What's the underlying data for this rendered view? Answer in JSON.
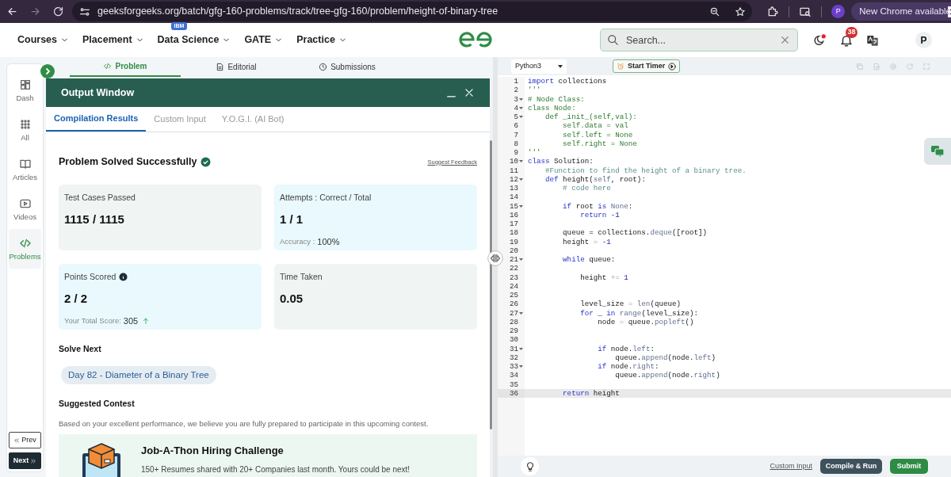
{
  "browser": {
    "url": "geeksforgeeks.org/batch/gfg-160-problems/track/tree-gfg-160/problem/height-of-binary-tree",
    "profile_initial": "P",
    "update_button": "New Chrome available"
  },
  "nav": {
    "items": [
      {
        "label": "Courses"
      },
      {
        "label": "Placement"
      },
      {
        "label": "Data Science",
        "badge": "IBM"
      },
      {
        "label": "GATE"
      },
      {
        "label": "Practice"
      }
    ],
    "search": {
      "placeholder": "Search..."
    },
    "notifications": "38",
    "avatar": "P"
  },
  "sidebar": {
    "items": [
      {
        "label": "Dash",
        "selected": false
      },
      {
        "label": "All",
        "selected": false
      },
      {
        "label": "Articles",
        "selected": false
      },
      {
        "label": "Videos",
        "selected": false
      },
      {
        "label": "Problems",
        "selected": true
      }
    ],
    "prev_button": "Prev",
    "next_button": "Next"
  },
  "problem_tabs": [
    {
      "label": "Problem",
      "selected": true
    },
    {
      "label": "Editorial",
      "selected": false
    },
    {
      "label": "Submissions",
      "selected": false
    }
  ],
  "output_window": {
    "title": "Output Window",
    "tabs": [
      {
        "label": "Compilation Results",
        "selected": true
      },
      {
        "label": "Custom Input",
        "selected": false
      },
      {
        "label": "Y.O.G.I. (AI Bot)",
        "selected": false
      }
    ],
    "result_title": "Problem Solved Successfully",
    "feedback_link": "Suggest Feedback",
    "cards": [
      {
        "label": "Test Cases Passed",
        "value": "1115 / 1115",
        "color": "#f0f5f4",
        "info": false
      },
      {
        "label": "Attempts : Correct / Total",
        "value": "1 / 1",
        "sub_label": "Accuracy :",
        "sub_value": "100%",
        "color": "#e9f9fd",
        "info": false,
        "rising": false
      },
      {
        "label": "Points Scored",
        "value": "2 / 2",
        "sub_label": "Your Total Score:",
        "sub_value": "305",
        "rising": true,
        "color": "#e9f9fd",
        "info": true
      },
      {
        "label": "Time Taken",
        "value": "0.05",
        "color": "#f0f5f4",
        "info": false
      }
    ],
    "solve_next": {
      "heading": "Solve Next",
      "link": "Day 82 - Diameter of a Binary Tree"
    },
    "suggested_contest": {
      "heading": "Suggested Contest",
      "description": "Based on your excellent performance, we believe you are fully prepared to participate in this upcoming contest.",
      "title": "Job-A-Thon Hiring Challenge",
      "text": "150+ Resumes shared with 20+ Companies last month. Yours could be next!"
    }
  },
  "editor": {
    "language": "Python3",
    "timer_button": "Start Timer",
    "lines": [
      {
        "n": "1",
        "fold": false,
        "active": false,
        "tokens": [
          {
            "kind": "keyword",
            "text": "import"
          },
          {
            "kind": "plain",
            "text": " collections"
          }
        ]
      },
      {
        "n": "2",
        "fold": false,
        "active": false,
        "tokens": [
          {
            "kind": "string",
            "text": "'''"
          }
        ]
      },
      {
        "n": "3",
        "fold": true,
        "active": false,
        "tokens": [
          {
            "kind": "string",
            "text": "# Node Class:"
          }
        ]
      },
      {
        "n": "4",
        "fold": true,
        "active": false,
        "tokens": [
          {
            "kind": "string",
            "text": "class Node:"
          }
        ]
      },
      {
        "n": "5",
        "fold": true,
        "active": false,
        "tokens": [
          {
            "kind": "string",
            "text": "    def _init_(self,val):"
          }
        ]
      },
      {
        "n": "6",
        "fold": false,
        "active": false,
        "tokens": [
          {
            "kind": "string",
            "text": "        self.data = val"
          }
        ]
      },
      {
        "n": "7",
        "fold": false,
        "active": false,
        "tokens": [
          {
            "kind": "string",
            "text": "        self.left = None"
          }
        ]
      },
      {
        "n": "8",
        "fold": false,
        "active": false,
        "tokens": [
          {
            "kind": "string",
            "text": "        self.right = None"
          }
        ]
      },
      {
        "n": "9",
        "fold": false,
        "active": false,
        "tokens": [
          {
            "kind": "string",
            "text": "'''"
          }
        ]
      },
      {
        "n": "10",
        "fold": true,
        "active": false,
        "tokens": [
          {
            "kind": "keyword",
            "text": "class"
          },
          {
            "kind": "plain",
            "text": " Solution:"
          }
        ]
      },
      {
        "n": "11",
        "fold": false,
        "active": false,
        "tokens": [
          {
            "kind": "comment",
            "text": "    #Function to find the height of a binary tree."
          }
        ]
      },
      {
        "n": "12",
        "fold": true,
        "active": false,
        "tokens": [
          {
            "kind": "keyword",
            "text": "    def"
          },
          {
            "kind": "plain",
            "text": " height("
          },
          {
            "kind": "builtin",
            "text": "self"
          },
          {
            "kind": "plain",
            "text": ", root):"
          }
        ]
      },
      {
        "n": "13",
        "fold": false,
        "active": false,
        "tokens": [
          {
            "kind": "comment",
            "text": "        # code here"
          }
        ]
      },
      {
        "n": "14",
        "fold": false,
        "active": false
      },
      {
        "n": "15",
        "fold": true,
        "active": false,
        "tokens": [
          {
            "kind": "keyword",
            "text": "        if"
          },
          {
            "kind": "plain",
            "text": " root "
          },
          {
            "kind": "keyword",
            "text": "is"
          },
          {
            "kind": "builtin",
            "text": " None"
          },
          {
            "kind": "plain",
            "text": ":"
          }
        ]
      },
      {
        "n": "16",
        "fold": false,
        "active": false,
        "tokens": [
          {
            "kind": "keyword",
            "text": "            return"
          },
          {
            "kind": "number",
            "text": " -1"
          }
        ]
      },
      {
        "n": "17",
        "fold": false,
        "active": false
      },
      {
        "n": "18",
        "fold": false,
        "active": false,
        "tokens": [
          {
            "kind": "plain",
            "text": "        queue = collections."
          },
          {
            "kind": "builtin",
            "text": "deque"
          },
          {
            "kind": "plain",
            "text": "([root])"
          }
        ]
      },
      {
        "n": "19",
        "fold": false,
        "active": false,
        "tokens": [
          {
            "kind": "plain",
            "text": "        height "
          },
          {
            "kind": "operator",
            "text": "="
          },
          {
            "kind": "number",
            "text": " -1"
          }
        ]
      },
      {
        "n": "20",
        "fold": false,
        "active": false
      },
      {
        "n": "21",
        "fold": true,
        "active": false,
        "tokens": [
          {
            "kind": "keyword",
            "text": "        while"
          },
          {
            "kind": "plain",
            "text": " queue:"
          }
        ]
      },
      {
        "n": "22",
        "fold": false,
        "active": false
      },
      {
        "n": "23",
        "fold": false,
        "active": false,
        "tokens": [
          {
            "kind": "plain",
            "text": "            height "
          },
          {
            "kind": "operator",
            "text": "+="
          },
          {
            "kind": "number",
            "text": " 1"
          }
        ]
      },
      {
        "n": "24",
        "fold": false,
        "active": false
      },
      {
        "n": "25",
        "fold": false,
        "active": false
      },
      {
        "n": "26",
        "fold": false,
        "active": false,
        "tokens": [
          {
            "kind": "plain",
            "text": "            level_size "
          },
          {
            "kind": "operator",
            "text": "="
          },
          {
            "kind": "builtin",
            "text": " len"
          },
          {
            "kind": "plain",
            "text": "(queue)"
          }
        ]
      },
      {
        "n": "27",
        "fold": true,
        "active": false,
        "tokens": [
          {
            "kind": "keyword",
            "text": "            for"
          },
          {
            "kind": "plain",
            "text": " _ "
          },
          {
            "kind": "keyword",
            "text": "in"
          },
          {
            "kind": "builtin",
            "text": " range"
          },
          {
            "kind": "plain",
            "text": "(level_size):"
          }
        ]
      },
      {
        "n": "28",
        "fold": false,
        "active": false,
        "tokens": [
          {
            "kind": "plain",
            "text": "                node "
          },
          {
            "kind": "operator",
            "text": "="
          },
          {
            "kind": "plain",
            "text": " queue."
          },
          {
            "kind": "builtin",
            "text": "popleft"
          },
          {
            "kind": "plain",
            "text": "()"
          }
        ]
      },
      {
        "n": "29",
        "fold": false,
        "active": false
      },
      {
        "n": "30",
        "fold": false,
        "active": false
      },
      {
        "n": "31",
        "fold": true,
        "active": false,
        "tokens": [
          {
            "kind": "keyword",
            "text": "                if"
          },
          {
            "kind": "plain",
            "text": " node."
          },
          {
            "kind": "builtin",
            "text": "left"
          },
          {
            "kind": "plain",
            "text": ":"
          }
        ]
      },
      {
        "n": "32",
        "fold": false,
        "active": false,
        "tokens": [
          {
            "kind": "plain",
            "text": "                    queue."
          },
          {
            "kind": "builtin",
            "text": "append"
          },
          {
            "kind": "plain",
            "text": "(node."
          },
          {
            "kind": "builtin",
            "text": "left"
          },
          {
            "kind": "plain",
            "text": ")"
          }
        ]
      },
      {
        "n": "33",
        "fold": true,
        "active": false,
        "tokens": [
          {
            "kind": "keyword",
            "text": "                if"
          },
          {
            "kind": "plain",
            "text": " node."
          },
          {
            "kind": "builtin",
            "text": "right"
          },
          {
            "kind": "plain",
            "text": ":"
          }
        ]
      },
      {
        "n": "34",
        "fold": false,
        "active": false,
        "tokens": [
          {
            "kind": "plain",
            "text": "                    queue."
          },
          {
            "kind": "builtin",
            "text": "append"
          },
          {
            "kind": "plain",
            "text": "(node."
          },
          {
            "kind": "builtin",
            "text": "right"
          },
          {
            "kind": "plain",
            "text": ")"
          }
        ]
      },
      {
        "n": "35",
        "fold": false,
        "active": false
      },
      {
        "n": "36",
        "fold": false,
        "active": true,
        "tokens": [
          {
            "kind": "keyword",
            "text": "        return"
          },
          {
            "kind": "plain",
            "text": " height"
          }
        ]
      }
    ],
    "custom_input_link": "Custom Input",
    "compile_button": "Compile & Run",
    "submit_button": "Submit"
  }
}
